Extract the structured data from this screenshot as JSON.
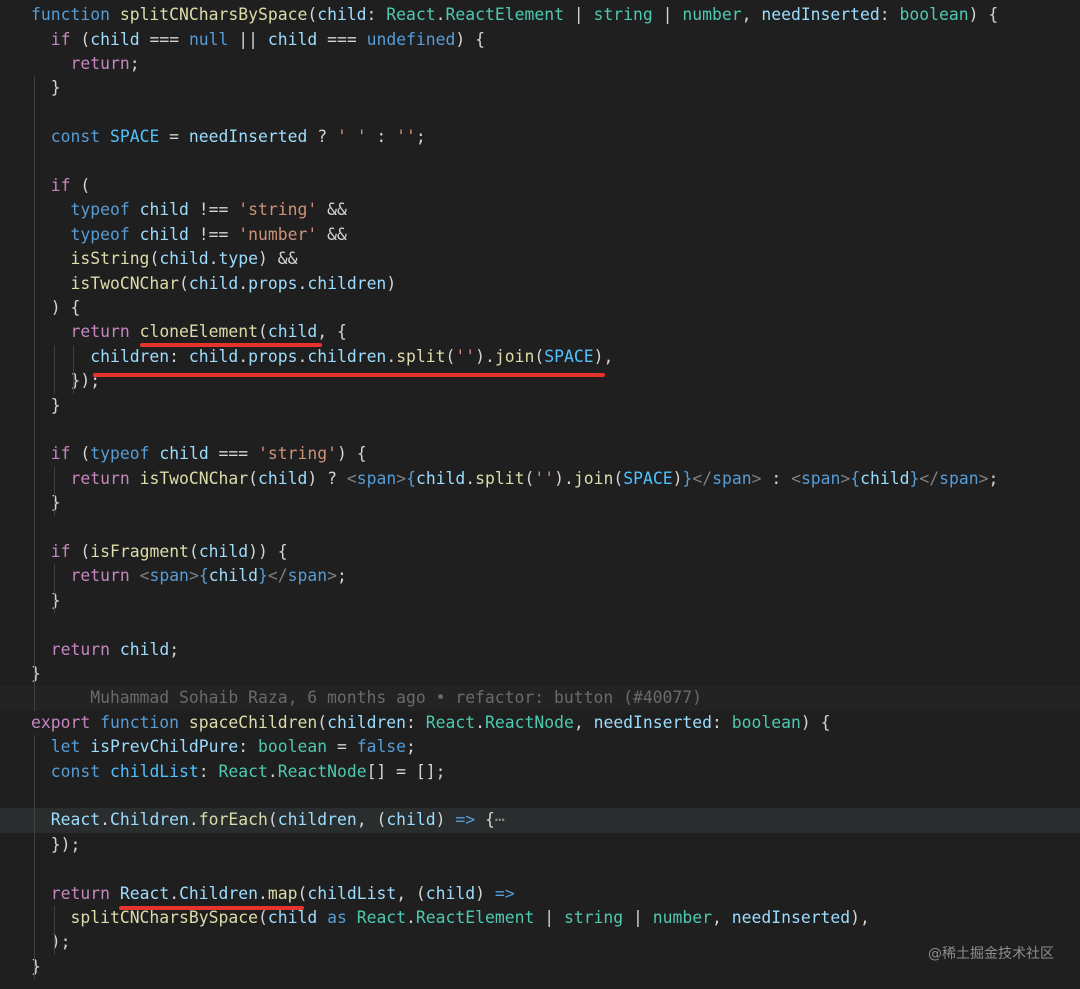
{
  "lines": [
    [
      [
        "kw",
        "function"
      ],
      [
        "pun",
        " "
      ],
      [
        "fn",
        "splitCNCharsBySpace"
      ],
      [
        "pun",
        "("
      ],
      [
        "var",
        "child"
      ],
      [
        "pun",
        ": "
      ],
      [
        "type",
        "React"
      ],
      [
        "pun",
        "."
      ],
      [
        "type",
        "ReactElement"
      ],
      [
        "pun",
        " | "
      ],
      [
        "type",
        "string"
      ],
      [
        "pun",
        " | "
      ],
      [
        "type",
        "number"
      ],
      [
        "pun",
        ", "
      ],
      [
        "var",
        "needInserted"
      ],
      [
        "pun",
        ": "
      ],
      [
        "type",
        "boolean"
      ],
      [
        "pun",
        ") {"
      ]
    ],
    [
      [
        "pun",
        "  "
      ],
      [
        "ctl",
        "if"
      ],
      [
        "pun",
        " ("
      ],
      [
        "var",
        "child"
      ],
      [
        "pun",
        " === "
      ],
      [
        "kw",
        "null"
      ],
      [
        "pun",
        " || "
      ],
      [
        "var",
        "child"
      ],
      [
        "pun",
        " === "
      ],
      [
        "kw",
        "undefined"
      ],
      [
        "pun",
        ") {"
      ]
    ],
    [
      [
        "pun",
        "    "
      ],
      [
        "ctl",
        "return"
      ],
      [
        "pun",
        ";"
      ]
    ],
    [
      [
        "pun",
        "  }"
      ]
    ],
    [],
    [
      [
        "pun",
        "  "
      ],
      [
        "kw",
        "const"
      ],
      [
        "pun",
        " "
      ],
      [
        "const",
        "SPACE"
      ],
      [
        "pun",
        " = "
      ],
      [
        "var",
        "needInserted"
      ],
      [
        "pun",
        " ? "
      ],
      [
        "str",
        "' '"
      ],
      [
        "pun",
        " : "
      ],
      [
        "str",
        "''"
      ],
      [
        "pun",
        ";"
      ]
    ],
    [],
    [
      [
        "pun",
        "  "
      ],
      [
        "ctl",
        "if"
      ],
      [
        "pun",
        " ("
      ]
    ],
    [
      [
        "pun",
        "    "
      ],
      [
        "kw",
        "typeof"
      ],
      [
        "pun",
        " "
      ],
      [
        "var",
        "child"
      ],
      [
        "pun",
        " !== "
      ],
      [
        "str",
        "'string'"
      ],
      [
        "pun",
        " &&"
      ]
    ],
    [
      [
        "pun",
        "    "
      ],
      [
        "kw",
        "typeof"
      ],
      [
        "pun",
        " "
      ],
      [
        "var",
        "child"
      ],
      [
        "pun",
        " !== "
      ],
      [
        "str",
        "'number'"
      ],
      [
        "pun",
        " &&"
      ]
    ],
    [
      [
        "pun",
        "    "
      ],
      [
        "fn",
        "isString"
      ],
      [
        "pun",
        "("
      ],
      [
        "var",
        "child"
      ],
      [
        "pun",
        "."
      ],
      [
        "var",
        "type"
      ],
      [
        "pun",
        ") &&"
      ]
    ],
    [
      [
        "pun",
        "    "
      ],
      [
        "fn",
        "isTwoCNChar"
      ],
      [
        "pun",
        "("
      ],
      [
        "var",
        "child"
      ],
      [
        "pun",
        "."
      ],
      [
        "var",
        "props"
      ],
      [
        "pun",
        "."
      ],
      [
        "var",
        "children"
      ],
      [
        "pun",
        ")"
      ]
    ],
    [
      [
        "pun",
        "  ) {"
      ]
    ],
    [
      [
        "pun",
        "    "
      ],
      [
        "ctl",
        "return"
      ],
      [
        "pun",
        " "
      ],
      [
        "fn",
        "cloneElement"
      ],
      [
        "pun",
        "("
      ],
      [
        "var",
        "child"
      ],
      [
        "pun",
        ", {"
      ]
    ],
    [
      [
        "pun",
        "      "
      ],
      [
        "var",
        "children"
      ],
      [
        "pun",
        ": "
      ],
      [
        "var",
        "child"
      ],
      [
        "pun",
        "."
      ],
      [
        "var",
        "props"
      ],
      [
        "pun",
        "."
      ],
      [
        "var",
        "children"
      ],
      [
        "pun",
        "."
      ],
      [
        "fn",
        "split"
      ],
      [
        "pun",
        "("
      ],
      [
        "str",
        "''"
      ],
      [
        "pun",
        ")."
      ],
      [
        "fn",
        "join"
      ],
      [
        "pun",
        "("
      ],
      [
        "const",
        "SPACE"
      ],
      [
        "pun",
        "),"
      ]
    ],
    [
      [
        "pun",
        "    });"
      ]
    ],
    [
      [
        "pun",
        "  }"
      ]
    ],
    [],
    [
      [
        "pun",
        "  "
      ],
      [
        "ctl",
        "if"
      ],
      [
        "pun",
        " ("
      ],
      [
        "kw",
        "typeof"
      ],
      [
        "pun",
        " "
      ],
      [
        "var",
        "child"
      ],
      [
        "pun",
        " === "
      ],
      [
        "str",
        "'string'"
      ],
      [
        "pun",
        ") {"
      ]
    ],
    [
      [
        "pun",
        "    "
      ],
      [
        "ctl",
        "return"
      ],
      [
        "pun",
        " "
      ],
      [
        "fn",
        "isTwoCNChar"
      ],
      [
        "pun",
        "("
      ],
      [
        "var",
        "child"
      ],
      [
        "pun",
        ") ? "
      ],
      [
        "tag",
        "<"
      ],
      [
        "tagname",
        "span"
      ],
      [
        "tag",
        ">"
      ],
      [
        "kw",
        "{"
      ],
      [
        "var",
        "child"
      ],
      [
        "pun",
        "."
      ],
      [
        "fn",
        "split"
      ],
      [
        "pun",
        "("
      ],
      [
        "str",
        "''"
      ],
      [
        "pun",
        ")."
      ],
      [
        "fn",
        "join"
      ],
      [
        "pun",
        "("
      ],
      [
        "const",
        "SPACE"
      ],
      [
        "pun",
        ")"
      ],
      [
        "kw",
        "}"
      ],
      [
        "tag",
        "</"
      ],
      [
        "tagname",
        "span"
      ],
      [
        "tag",
        ">"
      ],
      [
        "pun",
        " : "
      ],
      [
        "tag",
        "<"
      ],
      [
        "tagname",
        "span"
      ],
      [
        "tag",
        ">"
      ],
      [
        "kw",
        "{"
      ],
      [
        "var",
        "child"
      ],
      [
        "kw",
        "}"
      ],
      [
        "tag",
        "</"
      ],
      [
        "tagname",
        "span"
      ],
      [
        "tag",
        ">"
      ],
      [
        "pun",
        ";"
      ]
    ],
    [
      [
        "pun",
        "  }"
      ]
    ],
    [],
    [
      [
        "pun",
        "  "
      ],
      [
        "ctl",
        "if"
      ],
      [
        "pun",
        " ("
      ],
      [
        "fn",
        "isFragment"
      ],
      [
        "pun",
        "("
      ],
      [
        "var",
        "child"
      ],
      [
        "pun",
        ")) {"
      ]
    ],
    [
      [
        "pun",
        "    "
      ],
      [
        "ctl",
        "return"
      ],
      [
        "pun",
        " "
      ],
      [
        "tag",
        "<"
      ],
      [
        "tagname",
        "span"
      ],
      [
        "tag",
        ">"
      ],
      [
        "kw",
        "{"
      ],
      [
        "var",
        "child"
      ],
      [
        "kw",
        "}"
      ],
      [
        "tag",
        "</"
      ],
      [
        "tagname",
        "span"
      ],
      [
        "tag",
        ">"
      ],
      [
        "pun",
        ";"
      ]
    ],
    [
      [
        "pun",
        "  }"
      ]
    ],
    [],
    [
      [
        "pun",
        "  "
      ],
      [
        "ctl",
        "return"
      ],
      [
        "pun",
        " "
      ],
      [
        "var",
        "child"
      ],
      [
        "pun",
        ";"
      ]
    ],
    [
      [
        "pun",
        "}"
      ]
    ],
    [
      [
        "blametxt",
        "      Muhammad Sohaib Raza, 6 months ago • refactor: button (#40077)"
      ]
    ],
    [
      [
        "ctl",
        "export"
      ],
      [
        "pun",
        " "
      ],
      [
        "kw",
        "function"
      ],
      [
        "pun",
        " "
      ],
      [
        "fn",
        "spaceChildren"
      ],
      [
        "pun",
        "("
      ],
      [
        "var",
        "children"
      ],
      [
        "pun",
        ": "
      ],
      [
        "type",
        "React"
      ],
      [
        "pun",
        "."
      ],
      [
        "type",
        "ReactNode"
      ],
      [
        "pun",
        ", "
      ],
      [
        "var",
        "needInserted"
      ],
      [
        "pun",
        ": "
      ],
      [
        "type",
        "boolean"
      ],
      [
        "pun",
        ") {"
      ]
    ],
    [
      [
        "pun",
        "  "
      ],
      [
        "kw",
        "let"
      ],
      [
        "pun",
        " "
      ],
      [
        "var",
        "isPrevChildPure"
      ],
      [
        "pun",
        ": "
      ],
      [
        "type",
        "boolean"
      ],
      [
        "pun",
        " = "
      ],
      [
        "kw",
        "false"
      ],
      [
        "pun",
        ";"
      ]
    ],
    [
      [
        "pun",
        "  "
      ],
      [
        "kw",
        "const"
      ],
      [
        "pun",
        " "
      ],
      [
        "const",
        "childList"
      ],
      [
        "pun",
        ": "
      ],
      [
        "type",
        "React"
      ],
      [
        "pun",
        "."
      ],
      [
        "type",
        "ReactNode"
      ],
      [
        "pun",
        "[] = [];"
      ]
    ],
    [],
    [
      [
        "pun",
        "  "
      ],
      [
        "var",
        "React"
      ],
      [
        "pun",
        "."
      ],
      [
        "var",
        "Children"
      ],
      [
        "pun",
        "."
      ],
      [
        "fn",
        "forEach"
      ],
      [
        "pun",
        "("
      ],
      [
        "var",
        "children"
      ],
      [
        "pun",
        ", ("
      ],
      [
        "var",
        "child"
      ],
      [
        "pun",
        ") "
      ],
      [
        "kw",
        "=>"
      ],
      [
        "pun",
        " {"
      ],
      [
        "ellipsis",
        "⋯"
      ]
    ],
    [
      [
        "pun",
        "  });"
      ]
    ],
    [],
    [
      [
        "pun",
        "  "
      ],
      [
        "ctl",
        "return"
      ],
      [
        "pun",
        " "
      ],
      [
        "var",
        "React"
      ],
      [
        "pun",
        "."
      ],
      [
        "var",
        "Children"
      ],
      [
        "pun",
        "."
      ],
      [
        "fn",
        "map"
      ],
      [
        "pun",
        "("
      ],
      [
        "var",
        "childList"
      ],
      [
        "pun",
        ", ("
      ],
      [
        "var",
        "child"
      ],
      [
        "pun",
        ") "
      ],
      [
        "kw",
        "=>"
      ]
    ],
    [
      [
        "pun",
        "    "
      ],
      [
        "fn",
        "splitCNCharsBySpace"
      ],
      [
        "pun",
        "("
      ],
      [
        "var",
        "child"
      ],
      [
        "pun",
        " "
      ],
      [
        "kw",
        "as"
      ],
      [
        "pun",
        " "
      ],
      [
        "type",
        "React"
      ],
      [
        "pun",
        "."
      ],
      [
        "type",
        "ReactElement"
      ],
      [
        "pun",
        " | "
      ],
      [
        "type",
        "string"
      ],
      [
        "pun",
        " | "
      ],
      [
        "type",
        "number"
      ],
      [
        "pun",
        ", "
      ],
      [
        "var",
        "needInserted"
      ],
      [
        "pun",
        "),"
      ]
    ],
    [
      [
        "pun",
        "  );"
      ]
    ],
    [
      [
        "pun",
        "}"
      ]
    ]
  ],
  "watermark": "@稀土掘金技术社区",
  "fold_icon": "chevron-right-icon",
  "colors": {
    "background": "#1f1f1f",
    "keyword": "#569cd6",
    "control": "#c586c0",
    "function": "#dcdcaa",
    "variable": "#9cdcfe",
    "constant": "#4fc1ff",
    "type": "#4ec9b0",
    "string": "#ce9178",
    "annotation_underline": "#e8322c"
  }
}
